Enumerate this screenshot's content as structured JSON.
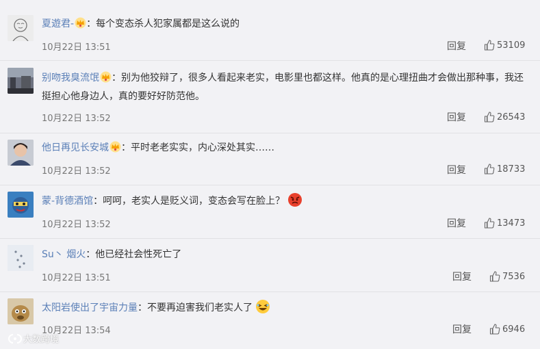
{
  "comments": [
    {
      "username": "夏遊君-",
      "colon": "：",
      "text": "每个变态杀人犯家属都是这么说的",
      "time": "10月22日 13:51",
      "reply": "回复",
      "likes": "53109",
      "crown": true
    },
    {
      "username": "别吻我臭流氓",
      "colon": "：",
      "text": "别为他狡辩了，很多人看起来老实，电影里也都这样。他真的是心理扭曲才会做出那种事，我还挺担心他身边人，真的要好好防范他。",
      "time": "10月22日 13:52",
      "reply": "回复",
      "likes": "26543",
      "crown": true
    },
    {
      "username": "他日再见长安城",
      "colon": "：",
      "text": "平时老老实实，内心深处其实……",
      "time": "10月22日 13:52",
      "reply": "回复",
      "likes": "18733",
      "crown": true
    },
    {
      "username": "蒙-背德酒馆",
      "colon": "：",
      "text": "呵呵，老实人是贬义词，变态会写在脸上？",
      "time": "10月22日 13:52",
      "reply": "回复",
      "likes": "13473",
      "emoji": "angry-face"
    },
    {
      "username": "Su丶 烟火",
      "colon": "：",
      "text": "他已经社会性死亡了",
      "time": "10月22日 13:51",
      "reply": "回复",
      "likes": "7536"
    },
    {
      "username": "太阳岩使出了宇宙力量",
      "colon": "：",
      "text": "不要再迫害我们老实人了",
      "time": "10月22日 13:54",
      "reply": "回复",
      "likes": "6946",
      "emoji": "laughing-face"
    }
  ],
  "watermark": "大数跨境",
  "colors": {
    "username": "#5a7fb7",
    "background": "#f2f2f5",
    "crown": "#f5b400"
  }
}
